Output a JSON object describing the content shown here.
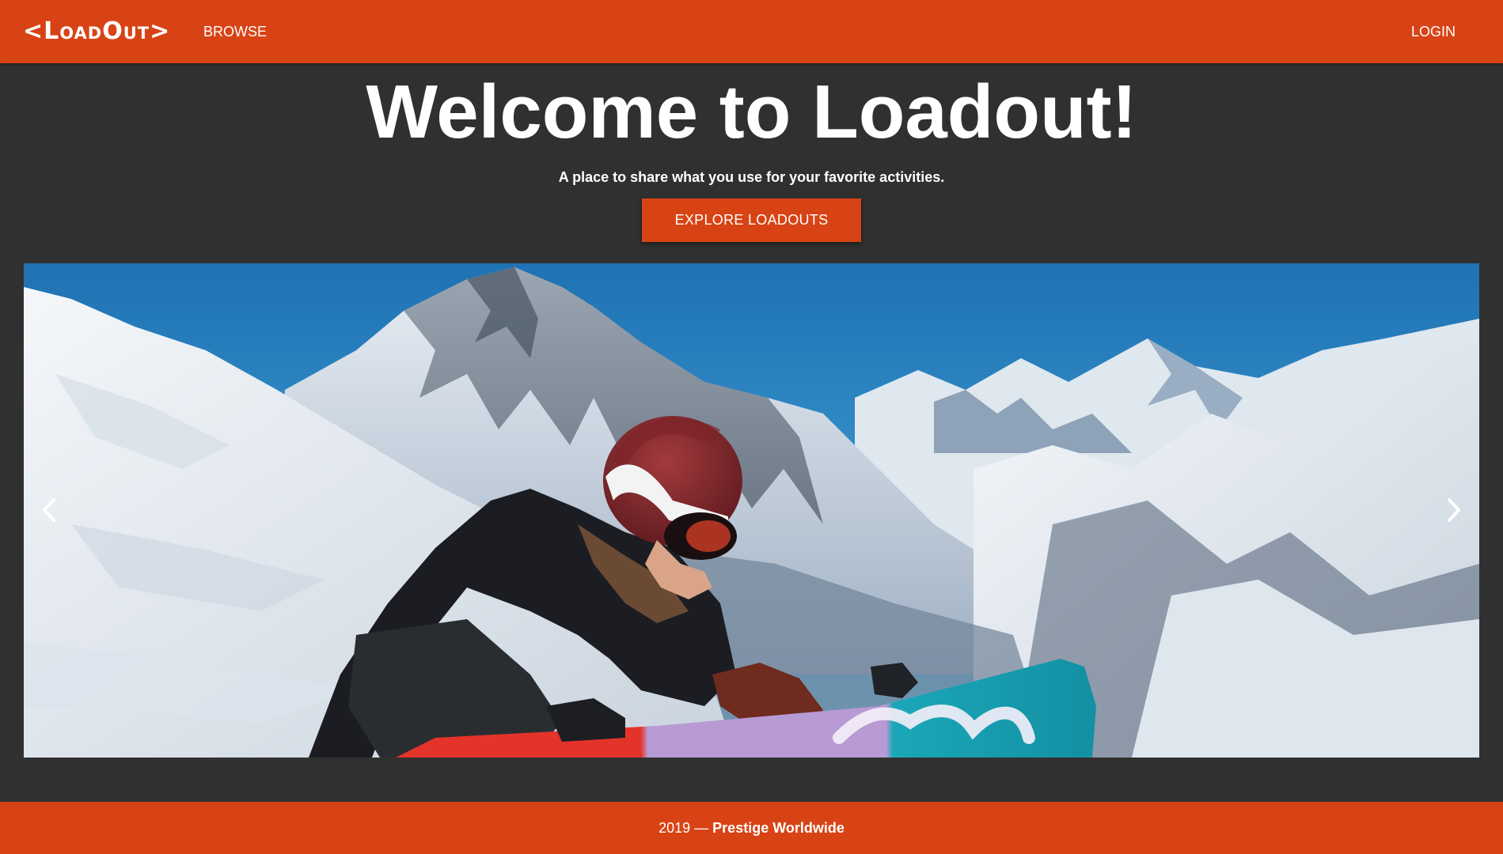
{
  "nav": {
    "logo_text": "LoadOut",
    "browse_label": "BROWSE",
    "login_label": "LOGIN"
  },
  "hero": {
    "title": "Welcome to Loadout!",
    "subtitle": "A place to share what you use for your favorite activities.",
    "cta_label": "EXPLORE LOADOUTS"
  },
  "carousel": {
    "prev_icon": "chevron-left-icon",
    "next_icon": "chevron-right-icon",
    "slide_subject": "snowboarder-in-mountains"
  },
  "footer": {
    "year_dash": "2019 — ",
    "brand": "Prestige Worldwide"
  },
  "colors": {
    "accent": "#d84315",
    "background": "#303030",
    "text": "#ffffff"
  }
}
